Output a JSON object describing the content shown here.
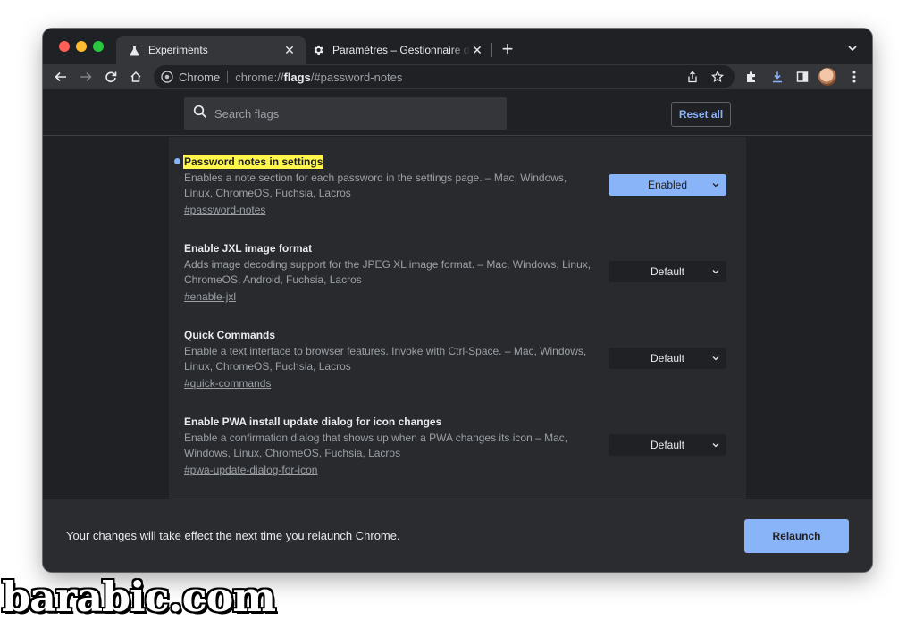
{
  "browser": {
    "tabs": [
      {
        "title": "Experiments",
        "icon": "flask-icon",
        "active": true
      },
      {
        "title": "Paramètres – Gestionnaire de mots de passe",
        "icon": "gear-icon",
        "active": false
      }
    ],
    "omnibox": {
      "site_chip": "Chrome",
      "url_prefix": "chrome://",
      "url_bold": "flags",
      "url_suffix": "/#password-notes"
    }
  },
  "header": {
    "search_placeholder": "Search flags",
    "reset_label": "Reset all"
  },
  "flags": [
    {
      "title": "Password notes in settings",
      "description": "Enables a note section for each password in the settings page. – Mac, Windows, Linux, ChromeOS, Fuchsia, Lacros",
      "link": "#password-notes",
      "value": "Enabled",
      "highlighted": true
    },
    {
      "title": "Enable JXL image format",
      "description": "Adds image decoding support for the JPEG XL image format. – Mac, Windows, Linux, ChromeOS, Android, Fuchsia, Lacros",
      "link": "#enable-jxl",
      "value": "Default",
      "highlighted": false
    },
    {
      "title": "Quick Commands",
      "description": "Enable a text interface to browser features. Invoke with Ctrl-Space. – Mac, Windows, Linux, ChromeOS, Fuchsia, Lacros",
      "link": "#quick-commands",
      "value": "Default",
      "highlighted": false
    },
    {
      "title": "Enable PWA install update dialog for icon changes",
      "description": "Enable a confirmation dialog that shows up when a PWA changes its icon – Mac, Windows, Linux, ChromeOS, Fuchsia, Lacros",
      "link": "#pwa-update-dialog-for-icon",
      "value": "Default",
      "highlighted": false
    }
  ],
  "relaunch": {
    "message": "Your changes will take effect the next time you relaunch Chrome.",
    "button_label": "Relaunch"
  },
  "watermark": "barabic.com",
  "colors": {
    "accent": "#8ab4f8",
    "highlight": "#fff84a",
    "background": "#202124",
    "panel": "#292a2d"
  }
}
